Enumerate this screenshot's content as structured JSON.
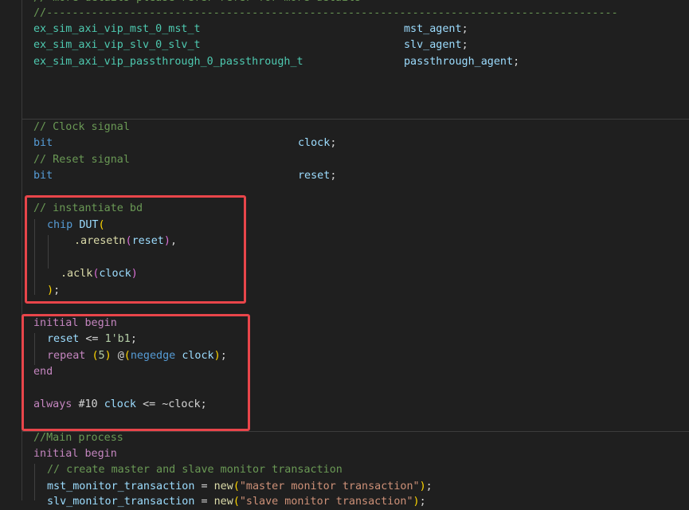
{
  "colors": {
    "background": "#1f1f1f",
    "comment": "#6a9955",
    "type": "#4ec9b0",
    "keyword": "#569cd6",
    "control": "#c586c0",
    "variable": "#9cdcfe",
    "function": "#dcdcaa",
    "string": "#ce9178",
    "number": "#b5cea8",
    "highlight": "#e8454a"
  },
  "code": {
    "top_comment": "// more details please refer refer for more details",
    "dashes": "//-----------------------------------------------------------------------------------------",
    "agents": [
      {
        "type": "ex_sim_axi_vip_mst_0_mst_t",
        "name": "mst_agent",
        "semi": ";"
      },
      {
        "type": "ex_sim_axi_vip_slv_0_slv_t",
        "name": "slv_agent",
        "semi": ";"
      },
      {
        "type": "ex_sim_axi_vip_passthrough_0_passthrough_t",
        "name": "passthrough_agent",
        "semi": ";"
      }
    ],
    "clock_comment": "// Clock signal",
    "clock_type": "bit",
    "clock_name": "clock",
    "reset_comment": "// Reset signal",
    "reset_type": "bit",
    "reset_name": "reset",
    "semi": ";",
    "inst": {
      "comment": "// instantiate bd",
      "module": "chip",
      "instance": "DUT",
      "open": "(",
      "port1": ".aresetn",
      "port1_open": "(",
      "port1_sig": "reset",
      "port1_close": ")",
      "comma": ",",
      "port2": ".aclk",
      "port2_open": "(",
      "port2_sig": "clock",
      "port2_close": ")",
      "close": ")",
      "end": ";"
    },
    "init": {
      "initial": "initial",
      "begin": "begin",
      "reset_sig": "reset",
      "assign_op": "<=",
      "reset_val": "1'b1",
      "repeat": "repeat",
      "repeat_open": "(",
      "repeat_num": "5",
      "repeat_close": ")",
      "at": "@",
      "ev_open": "(",
      "negedge": "negedge",
      "ev_sig": "clock",
      "ev_close": ")",
      "end": "end",
      "always": "always",
      "delay": "#10",
      "clk_sig": "clock",
      "not_clk": "~clock"
    },
    "main": {
      "comment": "//Main process",
      "initial": "initial",
      "begin": "begin",
      "comment2": "// create master and slave monitor transaction",
      "var1": "mst_monitor_transaction",
      "eq": "=",
      "new1": "new",
      "open": "(",
      "str1": "\"master monitor transaction\"",
      "close": ")",
      "var2": "slv_monitor_transaction",
      "str2": "\"slave monitor transaction\""
    }
  }
}
